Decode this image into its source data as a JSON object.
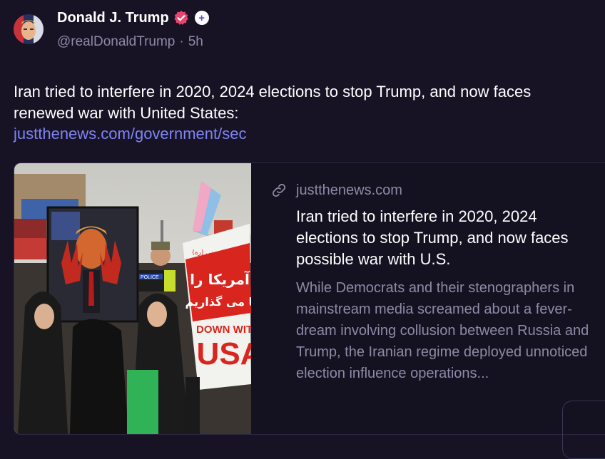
{
  "post": {
    "author_name": "Donald J. Trump",
    "handle": "@realDonaldTrump",
    "separator": "·",
    "time": "5h",
    "text": "Iran tried to interfere in 2020, 2024 elections to stop Trump, and now faces renewed war with United States:",
    "link_text": "justthenews.com/government/sec"
  },
  "badges": {
    "verified_icon": "verified-check-icon",
    "plus_label": "+"
  },
  "card": {
    "domain": "justthenews.com",
    "title": "Iran tried to interfere in 2020, 2024 elections to stop Trump, and now faces possible war with U.S.",
    "description": "While Democrats and their stenographers in mainstream media screamed about a fever-dream involving collusion between Russia and Trump, the Iranian regime deployed unnoticed election influence operations..."
  },
  "photo": {
    "police_label": "POLICE",
    "sign_text_1": "DOWN WITH",
    "sign_text_2": "USA",
    "arabic_top": "امام خمینی (ره)",
    "arabic_mid": "آمریکا را",
    "arabic_low": "ما می گذاریم"
  },
  "colors": {
    "accent_link": "#7e84f4",
    "background": "#171325",
    "muted": "#8f8aa6"
  }
}
